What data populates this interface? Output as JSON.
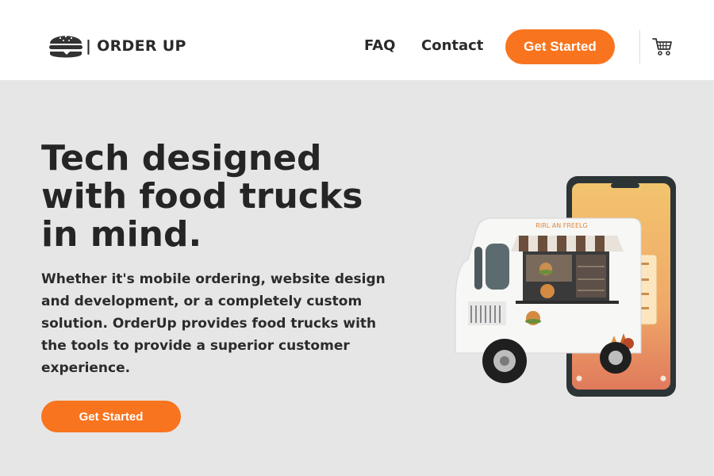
{
  "brand": {
    "logo_icon": "burger-icon",
    "name": "| ORDER UP"
  },
  "nav": {
    "links": [
      "FAQ",
      "Contact"
    ],
    "cta_label": "Get Started",
    "cart_icon": "shopping-cart-icon"
  },
  "hero": {
    "title_lines": [
      "Tech designed",
      "with food trucks",
      "in mind."
    ],
    "description": "Whether it's mobile ordering, website design and development, or a completely custom solution. OrderUp provides food trucks with the tools to provide a superior customer experience.",
    "cta_label": "Get Started",
    "illustration": "food-truck-with-phone",
    "truck_sign": "RIRL AN FREELG"
  },
  "colors": {
    "accent": "#f8741e",
    "text_dark": "#252525",
    "hero_background": "#e6e6e6",
    "nav_background": "#ffffff"
  }
}
